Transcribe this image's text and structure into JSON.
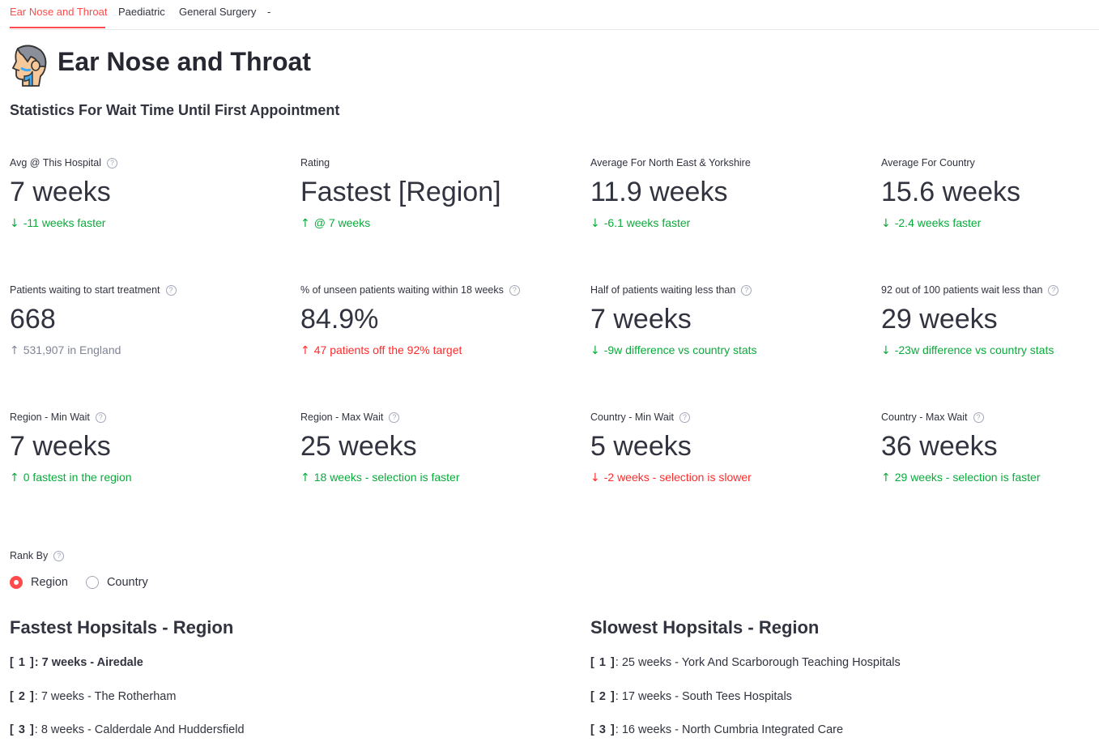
{
  "tabs": [
    {
      "label": "Ear Nose and Throat"
    },
    {
      "label": "Paediatric"
    },
    {
      "label": "General Surgery"
    },
    {
      "label": "-"
    }
  ],
  "header": {
    "title": "Ear Nose and Throat",
    "icon": "ent-patient-icon",
    "subtitle": "Statistics For Wait Time Until First Appointment"
  },
  "metrics": [
    {
      "label": "Avg @ This Hospital",
      "value": "7 weeks",
      "delta": "-11 weeks faster",
      "direction": "down",
      "color": "green"
    },
    {
      "label": "Rating",
      "value": "Fastest [Region]",
      "delta": "@ 7 weeks",
      "direction": "up",
      "color": "green"
    },
    {
      "label": "Average For North East & Yorkshire",
      "value": "11.9 weeks",
      "delta": "-6.1 weeks faster",
      "direction": "down",
      "color": "green"
    },
    {
      "label": "Average For Country",
      "value": "15.6 weeks",
      "delta": "-2.4 weeks faster",
      "direction": "down",
      "color": "green"
    },
    {
      "label": "Patients waiting to start treatment",
      "value": "668",
      "delta": "531,907 in England",
      "direction": "up",
      "color": "gray"
    },
    {
      "label": "% of unseen patients waiting within 18 weeks",
      "value": "84.9%",
      "delta": "47 patients off the 92% target",
      "direction": "up",
      "color": "red"
    },
    {
      "label": "Half of patients waiting less than",
      "value": "7 weeks",
      "delta": "-9w difference vs country stats",
      "direction": "down",
      "color": "green"
    },
    {
      "label": "92 out of 100 patients wait less than",
      "value": "29 weeks",
      "delta": "-23w difference vs country stats",
      "direction": "down",
      "color": "green"
    },
    {
      "label": "Region - Min Wait",
      "value": "7 weeks",
      "delta": "0 fastest in the region",
      "direction": "up",
      "color": "green"
    },
    {
      "label": "Region - Max Wait",
      "value": "25 weeks",
      "delta": "18 weeks - selection is faster",
      "direction": "up",
      "color": "green"
    },
    {
      "label": "Country - Min Wait",
      "value": "5 weeks",
      "delta": "-2 weeks - selection is slower",
      "direction": "down",
      "color": "red"
    },
    {
      "label": "Country - Max Wait",
      "value": "36 weeks",
      "delta": "29 weeks - selection is faster",
      "direction": "up",
      "color": "green"
    }
  ],
  "rank_by": {
    "label": "Rank By",
    "options": [
      "Region",
      "Country"
    ],
    "selected": "Region"
  },
  "fastest": {
    "title": "Fastest Hopsitals - Region",
    "items": [
      {
        "rank": "[ 1 ]",
        "text": ": 7 weeks - Airedale"
      },
      {
        "rank": "[ 2 ]",
        "text": ": 7 weeks - The Rotherham"
      },
      {
        "rank": "[ 3 ]",
        "text": ": 8 weeks - Calderdale And Huddersfield"
      }
    ]
  },
  "slowest": {
    "title": "Slowest Hopsitals - Region",
    "items": [
      {
        "rank": "[ 1 ]",
        "text": ": 25 weeks - York And Scarborough Teaching Hospitals"
      },
      {
        "rank": "[ 2 ]",
        "text": ": 17 weeks - South Tees Hospitals"
      },
      {
        "rank": "[ 3 ]",
        "text": ": 16 weeks - North Cumbria Integrated Care"
      }
    ]
  },
  "colors": {
    "accent": "#ff4b4b",
    "positive": "#09ab3b",
    "negative": "#ff2b2b",
    "neutral": "#808495"
  }
}
